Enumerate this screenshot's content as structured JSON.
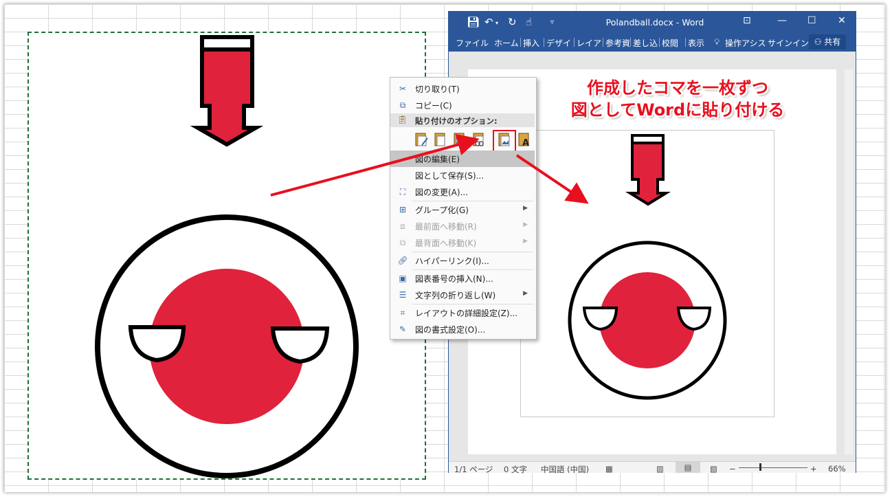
{
  "word_window": {
    "title": "Polandball.docx - Word",
    "quick_access": [
      "save-icon",
      "undo-icon",
      "redo-icon",
      "touch-mode-icon",
      "customize-qat-icon"
    ],
    "tabs": [
      "ファイル",
      "ホーム",
      "挿入",
      "デザイン",
      "レイア",
      "参考資",
      "差し込",
      "校閲",
      "表示"
    ],
    "tell_me": "操作アシス",
    "sign_in": "サインイン",
    "share": "共有",
    "status": {
      "page": "1/1 ページ",
      "words": "0 文字",
      "language": "中国語 (中国)",
      "zoom": "66%"
    }
  },
  "context_menu": {
    "items": [
      {
        "label": "切り取り(T)",
        "icon": "scissors-icon"
      },
      {
        "label": "コピー(C)",
        "icon": "copy-icon"
      },
      {
        "label": "貼り付けのオプション:",
        "icon": "paste-icon"
      },
      {
        "label": "図の編集(E)",
        "icon": ""
      },
      {
        "label": "図として保存(S)...",
        "icon": ""
      },
      {
        "label": "図の変更(A)...",
        "icon": "change-picture-icon"
      },
      {
        "label": "グループ化(G)",
        "icon": "group-icon"
      },
      {
        "label": "最前面へ移動(R)",
        "icon": "bring-front-icon"
      },
      {
        "label": "最背面へ移動(K)",
        "icon": "send-back-icon"
      },
      {
        "label": "ハイパーリンク(I)...",
        "icon": "hyperlink-icon"
      },
      {
        "label": "図表番号の挿入(N)...",
        "icon": "caption-icon"
      },
      {
        "label": "文字列の折り返し(W)",
        "icon": "wrap-text-icon"
      },
      {
        "label": "レイアウトの詳細設定(Z)...",
        "icon": "layout-icon"
      },
      {
        "label": "図の書式設定(O)...",
        "icon": "format-picture-icon"
      }
    ],
    "paste_options": [
      "use-destination-theme-icon",
      "keep-source-formatting-icon",
      "link-destination-icon",
      "link-source-icon",
      "picture-icon",
      "keep-text-only-icon"
    ]
  },
  "annotation": {
    "line1": "作成したコマを一枚ずつ",
    "line2": "図としてWordに貼り付ける"
  },
  "colors": {
    "polandball_red": "#E0223C",
    "word_blue": "#2B579A",
    "annotation_red": "#E8101E",
    "selection_dash": "#1F6E3A"
  }
}
